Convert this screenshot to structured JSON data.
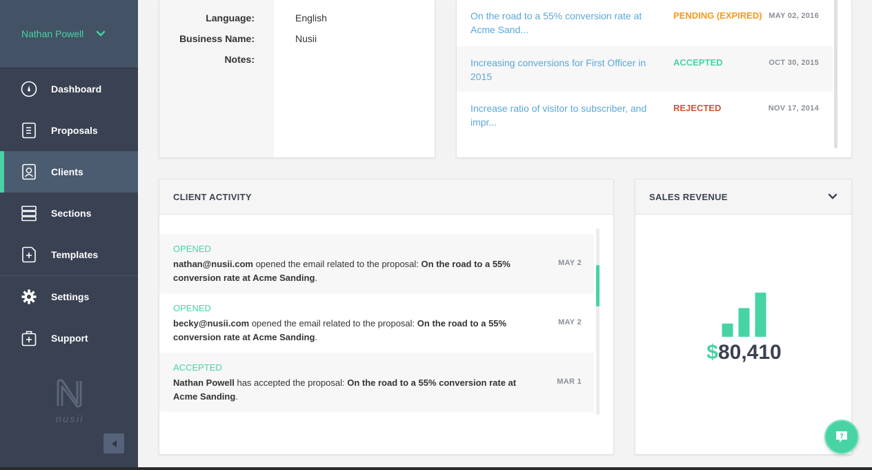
{
  "sidebar": {
    "user_name": "Nathan Powell",
    "items": [
      {
        "label": "Dashboard",
        "icon": "dashboard-icon"
      },
      {
        "label": "Proposals",
        "icon": "proposals-icon"
      },
      {
        "label": "Clients",
        "icon": "clients-icon",
        "active": true
      },
      {
        "label": "Sections",
        "icon": "sections-icon"
      },
      {
        "label": "Templates",
        "icon": "templates-icon"
      },
      {
        "label": "Settings",
        "icon": "gear-icon"
      },
      {
        "label": "Support",
        "icon": "support-icon"
      }
    ],
    "brand": "nusii"
  },
  "details": {
    "rows": [
      {
        "label": "Language:",
        "value": "English"
      },
      {
        "label": "Business Name:",
        "value": "Nusii"
      },
      {
        "label": "Notes:",
        "value": ""
      }
    ]
  },
  "proposals": {
    "rows": [
      {
        "title": "On the road to a 55% conversion rate at Acme Sand...",
        "status": "PENDING (EXPIRED)",
        "status_color": "#f39a1f",
        "date": "MAY 02, 2016"
      },
      {
        "title": "Increasing conversions for First Officer in 2015",
        "status": "ACCEPTED",
        "status_color": "#47d3a4",
        "date": "OCT 30, 2015"
      },
      {
        "title": "Increase ratio of visitor to subscriber, and impr...",
        "status": "REJECTED",
        "status_color": "#c9533b",
        "date": "NOV 17, 2014"
      }
    ]
  },
  "activity": {
    "title": "CLIENT ACTIVITY",
    "items": [
      {
        "type": "OPENED",
        "actor": "nathan@nusii.com",
        "action": " opened the email related to the proposal: ",
        "proposal": "On the road to a 55% conversion rate at Acme Sanding",
        "end": ".",
        "date": "MAY 2"
      },
      {
        "type": "OPENED",
        "actor": "becky@nusii.com",
        "action": " opened the email related to the proposal: ",
        "proposal": "On the road to a 55% conversion rate at Acme Sanding",
        "end": ".",
        "date": "MAY 2"
      },
      {
        "type": "ACCEPTED",
        "actor": "Nathan Powell",
        "action": " has accepted the proposal: ",
        "proposal": "On the road to a 55% conversion rate at Acme Sanding",
        "end": ".",
        "date": "MAR 1"
      }
    ]
  },
  "revenue": {
    "title": "SALES REVENUE",
    "currency": "$",
    "amount": "80,410",
    "bar_levels": [
      0.3,
      0.65,
      1.0
    ]
  },
  "colors": {
    "accent": "#47d3a4",
    "sidebar_bg": "#394152",
    "link": "#5aa7d8"
  }
}
